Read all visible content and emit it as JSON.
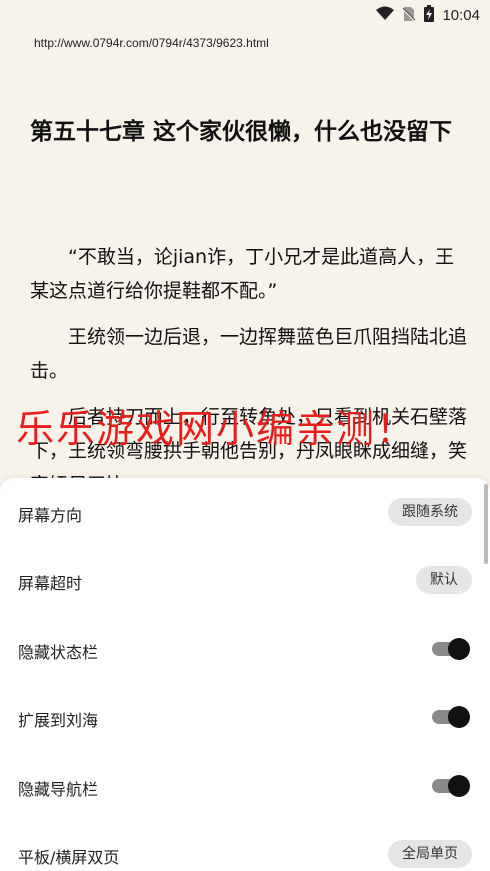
{
  "status_bar": {
    "time": "10:04",
    "icons": [
      "wifi-icon",
      "no-signal-icon",
      "battery-charging-icon"
    ]
  },
  "reader": {
    "url": "http://www.0794r.com/0794r/4373/9623.html",
    "chapter_title": "第五十七章 这个家伙很懒，什么也没留下",
    "paragraphs": [
      "“不敢当，论jian诈，丁小兄才是此道高人，王某这点道行给你提鞋都不配。”",
      "王统领一边后退，一边挥舞蓝色巨爪阻挡陆北追击。",
      "后者持刀而上，行至转角处，只看到机关石壁落下，王统领弯腰拱手朝他告别，丹凤眼眯成细缝，笑容妩尽无比。"
    ]
  },
  "watermark": "乐乐游戏网小编亲测！",
  "settings": {
    "screen_orientation": {
      "label": "屏幕方向",
      "value": "跟随系统"
    },
    "screen_timeout": {
      "label": "屏幕超时",
      "value": "默认"
    },
    "hide_status_bar": {
      "label": "隐藏状态栏",
      "enabled": true
    },
    "extend_to_notch": {
      "label": "扩展到刘海",
      "enabled": true
    },
    "hide_nav_bar": {
      "label": "隐藏导航栏",
      "enabled": true
    },
    "tablet_dual_page": {
      "label": "平板/横屏双页",
      "value": "全局单页"
    }
  },
  "colors": {
    "page_background": "#f7f2ea",
    "sheet_background": "#ffffff",
    "watermark": "#e61e1e",
    "chip_background": "#e5e5e5",
    "switch_thumb": "#111111",
    "switch_track": "#8a8a8a"
  }
}
